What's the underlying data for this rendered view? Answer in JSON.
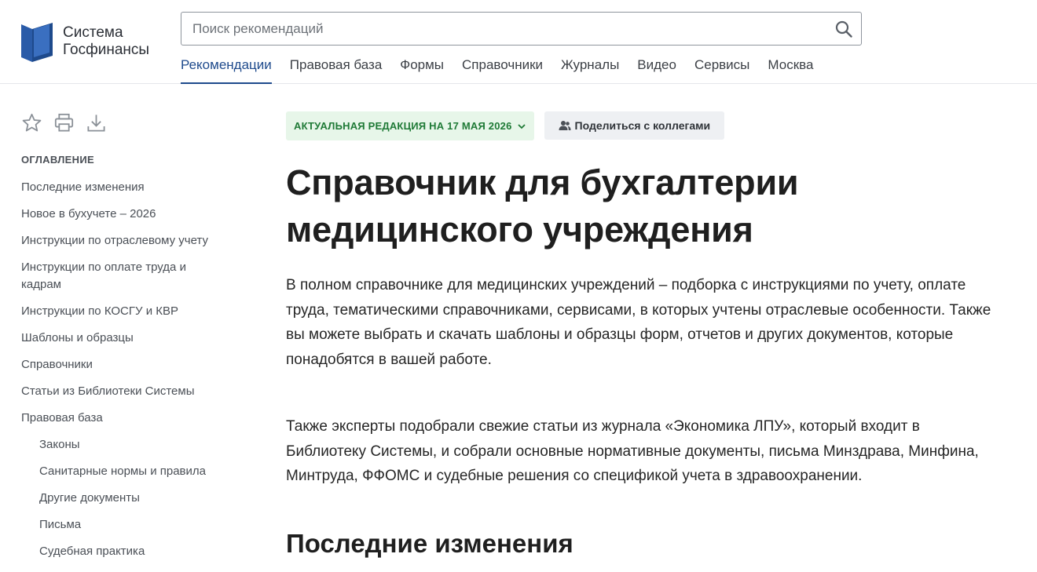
{
  "brand": {
    "line1": "Система",
    "line2": "Госфинансы",
    "color": "#1e4a8c"
  },
  "search": {
    "placeholder": "Поиск рекомендаций",
    "icon": "search-icon"
  },
  "nav": {
    "items": [
      {
        "label": "Рекомендации",
        "active": true
      },
      {
        "label": "Правовая база"
      },
      {
        "label": "Формы"
      },
      {
        "label": "Справочники"
      },
      {
        "label": "Журналы"
      },
      {
        "label": "Видео"
      },
      {
        "label": "Сервисы"
      },
      {
        "label": "Москва"
      }
    ]
  },
  "toolbar": {
    "icons": [
      "star-icon",
      "print-icon",
      "download-icon"
    ]
  },
  "toc": {
    "title": "ОГЛАВЛЕНИЕ",
    "items": [
      "Последние изменения",
      "Новое в бухучете – 2026",
      "Инструкции по отраслевому учету",
      "Инструкции по оплате труда и кадрам",
      "Инструкции по КОСГУ и КВР",
      "Шаблоны и образцы",
      "Справочники",
      "Статьи из Библиотеки Системы",
      "Правовая база"
    ],
    "subitems": [
      "Законы",
      "Санитарные нормы и правила",
      "Другие документы",
      "Письма",
      "Судебная практика"
    ]
  },
  "main": {
    "edition_badge": "АКТУАЛЬНАЯ РЕДАКЦИЯ НА 17 МАЯ 2026",
    "share_button": "Поделиться с коллегами",
    "title": "Справочник для бухгалтерии медицинского учреждения",
    "paragraph1": "В полном справочнике для медицинских учреждений – подборка с инструкциями по учету, оплате труда, тематическими справочниками, сервисами, в которых учтены отраслевые особенности. Также вы можете выбрать и скачать шаблоны и образцы форм, отчетов и других документов, которые понадобятся в вашей работе.",
    "paragraph2": "Также эксперты подобрали свежие статьи из журнала «Экономика ЛПУ», который входит в Библиотеку Системы, и собрали основные нормативные документы, письма Минздрава, Минфина, Минтруда, ФФОМС и судебные решения со спецификой учета в здравоохранении.",
    "section_title": "Последние изменения"
  }
}
